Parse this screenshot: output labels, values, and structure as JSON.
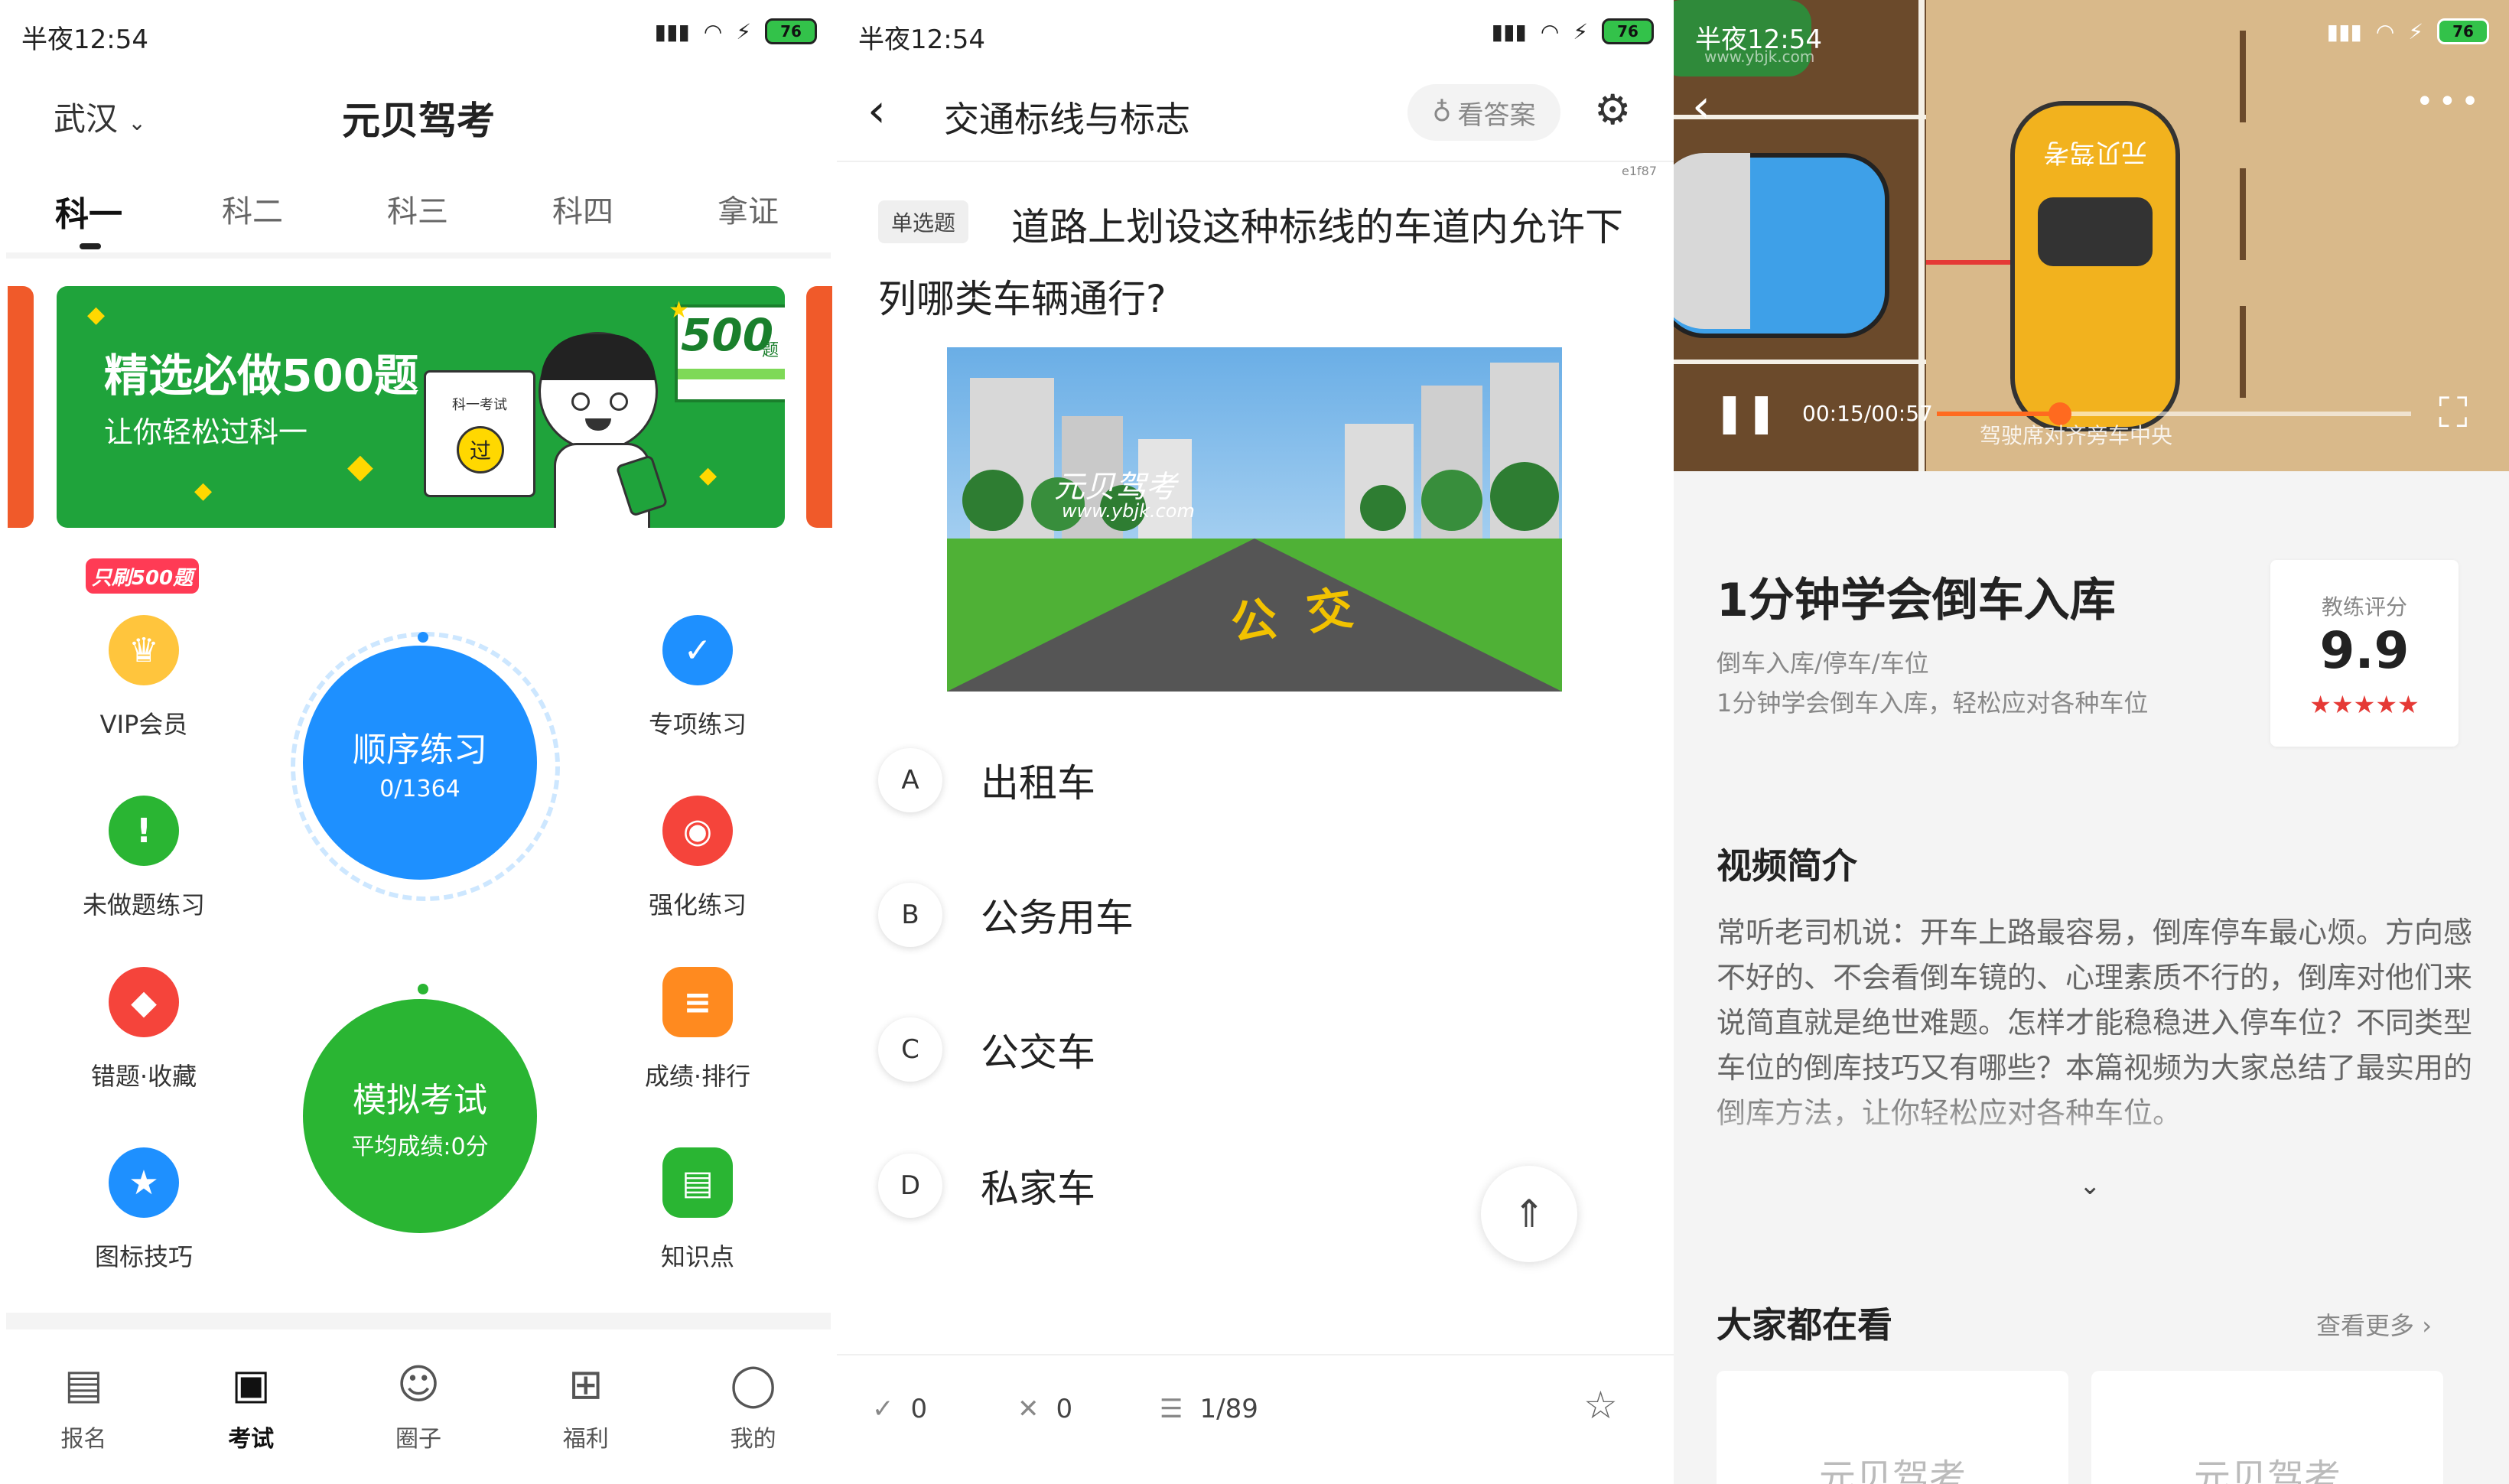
{
  "status_bar": {
    "time": "半夜12:54",
    "battery": "76"
  },
  "panel1": {
    "city": "武汉",
    "title": "元贝驾考",
    "tabs": [
      "科一",
      "科二",
      "科三",
      "科四",
      "拿证"
    ],
    "banner": {
      "title": "精选必做500题",
      "subtitle": "让你轻松过科一",
      "badge_num": "500",
      "badge_unit": "题",
      "card_label": "科一考试",
      "card_stamp": "过"
    },
    "vip_tag": "只刷500题",
    "features": {
      "vip": "VIP会员",
      "special": "专项练习",
      "undone": "未做题练习",
      "strengthen": "强化练习",
      "mistakes": "错题·收藏",
      "ranking": "成绩·排行",
      "sign_tips": "图标技巧",
      "knowledge": "知识点"
    },
    "order_practice": {
      "label": "顺序练习",
      "progress": "0/1364"
    },
    "mock_exam": {
      "label": "模拟考试",
      "score": "平均成绩:0分"
    },
    "bottom_nav": [
      "报名",
      "考试",
      "圈子",
      "福利",
      "我的"
    ],
    "colors": {
      "green": "#1fa33b",
      "blue": "#1e90ff",
      "exam_green": "#2ab533"
    }
  },
  "panel2": {
    "title": "交通标线与标志",
    "answer_button": "看答案",
    "code": "e1f87",
    "question_type": "单选题",
    "question": "道路上划设这种标线的车道内允许下列哪类车辆通行?",
    "image_watermark": "元贝驾考",
    "image_url": "www.ybjk.com",
    "road_text": "公交",
    "options": [
      {
        "key": "A",
        "text": "出租车"
      },
      {
        "key": "B",
        "text": "公务用车"
      },
      {
        "key": "C",
        "text": "公交车"
      },
      {
        "key": "D",
        "text": "私家车"
      }
    ],
    "footer": {
      "correct": "0",
      "wrong": "0",
      "progress": "1/89"
    }
  },
  "panel3": {
    "video": {
      "time": "00:15/00:57",
      "subtitle": "驾驶席对齐旁车中央",
      "car_text": "元贝驾考",
      "watermark": "www.ybjk.com",
      "progress": 0.26
    },
    "title": "1分钟学会倒车入库",
    "tags": "倒车入库/停车/车位",
    "desc": "1分钟学会倒车入库，轻松应对各种车位",
    "rating_label": "教练评分",
    "rating": "9.9",
    "intro_title": "视频简介",
    "intro_text": "常听老司机说：开车上路最容易，倒库停车最心烦。方向感不好的、不会看倒车镜的、心理素质不行的，倒库对他们来说简直就是绝世难题。怎样才能稳稳进入停车位？不同类型车位的倒库技巧又有哪些？本篇视频为大家总结了最实用的倒库方法，让你轻松应对各种车位。",
    "popular_title": "大家都在看",
    "more": "查看更多",
    "card_texts": [
      "元贝驾考",
      "元贝驾考"
    ]
  }
}
